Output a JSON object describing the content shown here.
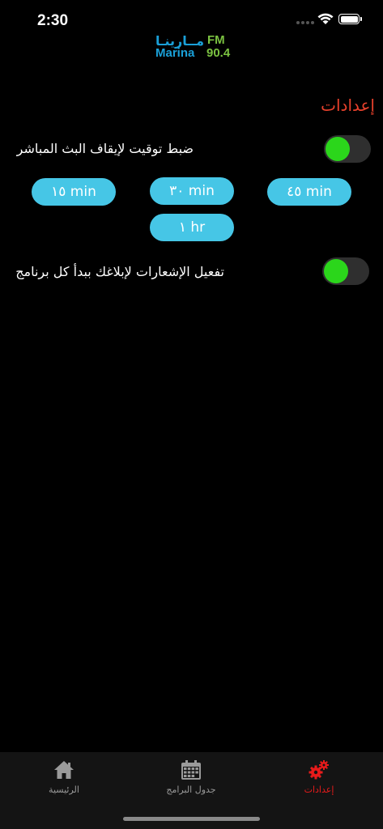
{
  "status_bar": {
    "time": "2:30"
  },
  "logo": {
    "arabic": "مــارينـا",
    "fm": "FM",
    "english": "Marina",
    "frequency": "90.4"
  },
  "settings": {
    "title": "إعدادات",
    "auto_stop_label": "ضبط توقيت لإيقاف البث المباشر",
    "auto_stop_enabled": true,
    "timer_options": [
      "١٥ min",
      "٣٠ min",
      "٤٥ min",
      "١ hr"
    ],
    "notifications_label": "تفعيل الإشعارات لإبلاغك ببدأ كل برنامج",
    "notifications_enabled": true
  },
  "tab_bar": {
    "home": "الرئيسية",
    "schedule": "جدول البرامج",
    "settings": "إعدادات",
    "active": "settings"
  },
  "colors": {
    "accent_red": "#e8412c",
    "toggle_on": "#2bd61b",
    "button_blue": "#46c6e6",
    "logo_blue": "#1aa0d8",
    "logo_green": "#7bc241"
  }
}
